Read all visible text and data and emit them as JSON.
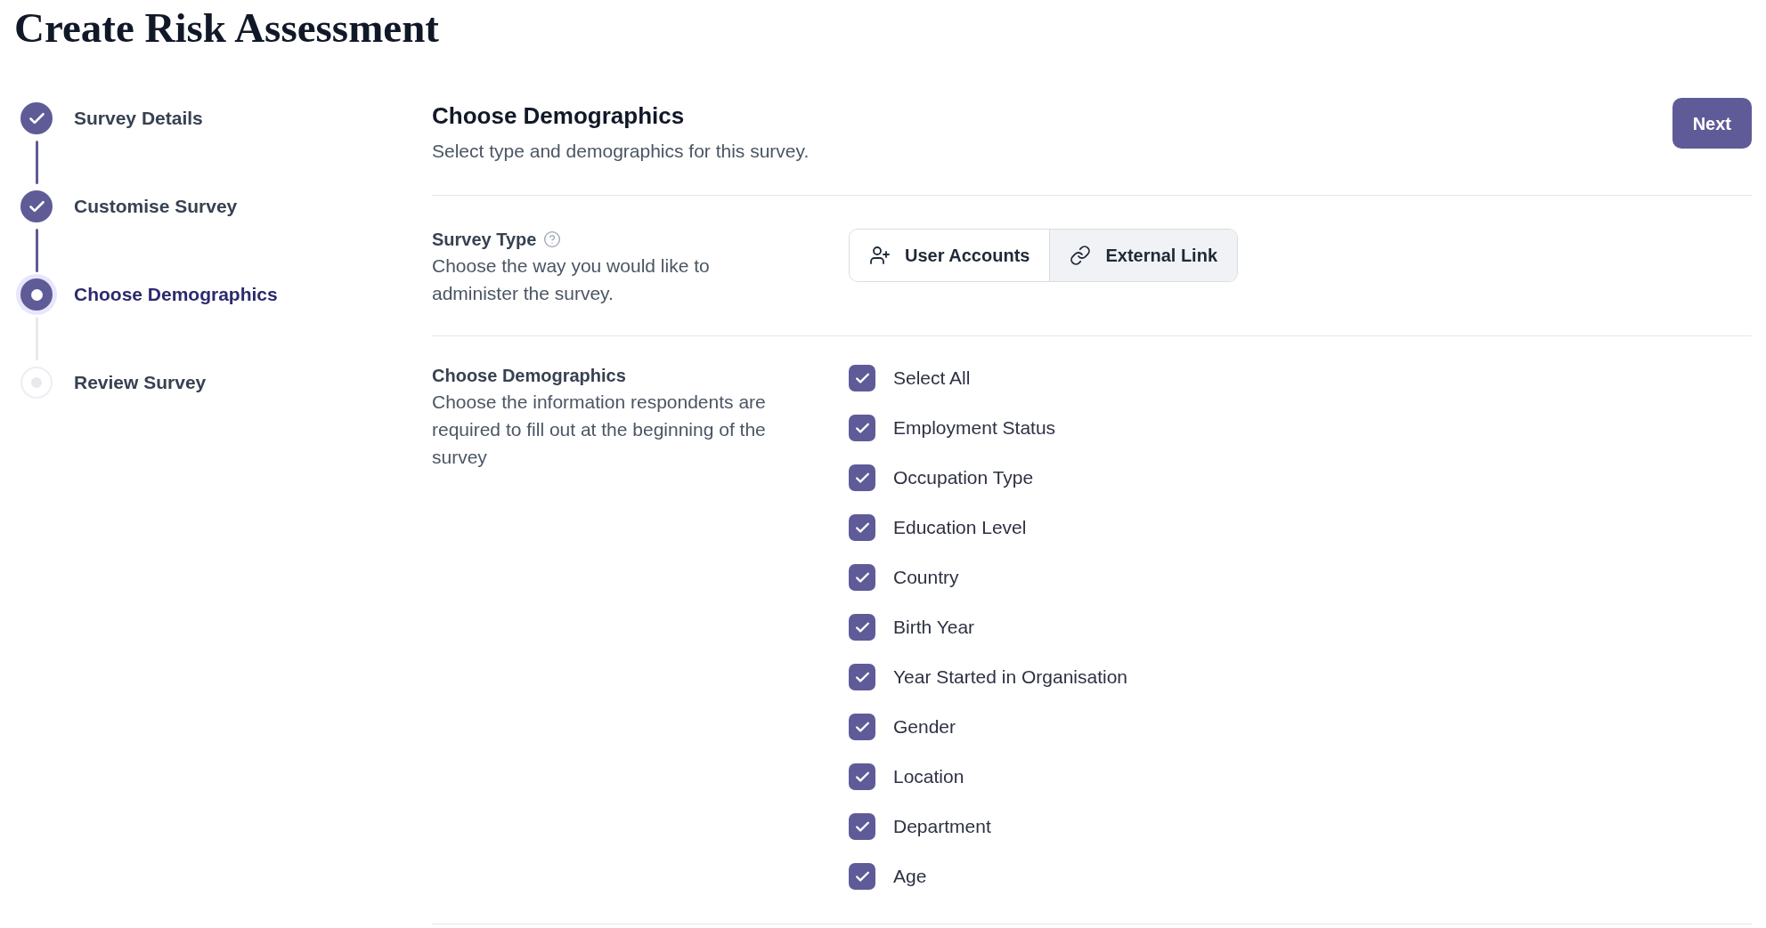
{
  "page_title": "Create Risk Assessment",
  "steps": [
    {
      "label": "Survey Details",
      "completed": true,
      "selected": false
    },
    {
      "label": "Customise Survey",
      "completed": true,
      "selected": false
    },
    {
      "label": "Choose Demographics",
      "completed": false,
      "selected": true
    },
    {
      "label": "Review Survey",
      "completed": false,
      "selected": false
    }
  ],
  "header": {
    "title": "Choose Demographics",
    "subtitle": "Select type and demographics for this survey.",
    "next_button": "Next"
  },
  "survey_type": {
    "label": "Survey Type",
    "description": "Choose the way you would like to administer the survey.",
    "options": [
      {
        "label": "User Accounts",
        "kind": "users",
        "selected": false
      },
      {
        "label": "External Link",
        "kind": "link",
        "selected": true
      }
    ]
  },
  "demographics": {
    "label": "Choose Demographics",
    "description": "Choose the information respondents are required to fill out at the beginning of the survey",
    "options": [
      {
        "label": "Select All",
        "checked": true
      },
      {
        "label": "Employment Status",
        "checked": true
      },
      {
        "label": "Occupation Type",
        "checked": true
      },
      {
        "label": "Education Level",
        "checked": true
      },
      {
        "label": "Country",
        "checked": true
      },
      {
        "label": "Birth Year",
        "checked": true
      },
      {
        "label": "Year Started in Organisation",
        "checked": true
      },
      {
        "label": "Gender",
        "checked": true
      },
      {
        "label": "Location",
        "checked": true
      },
      {
        "label": "Department",
        "checked": true
      },
      {
        "label": "Age",
        "checked": true
      }
    ]
  }
}
